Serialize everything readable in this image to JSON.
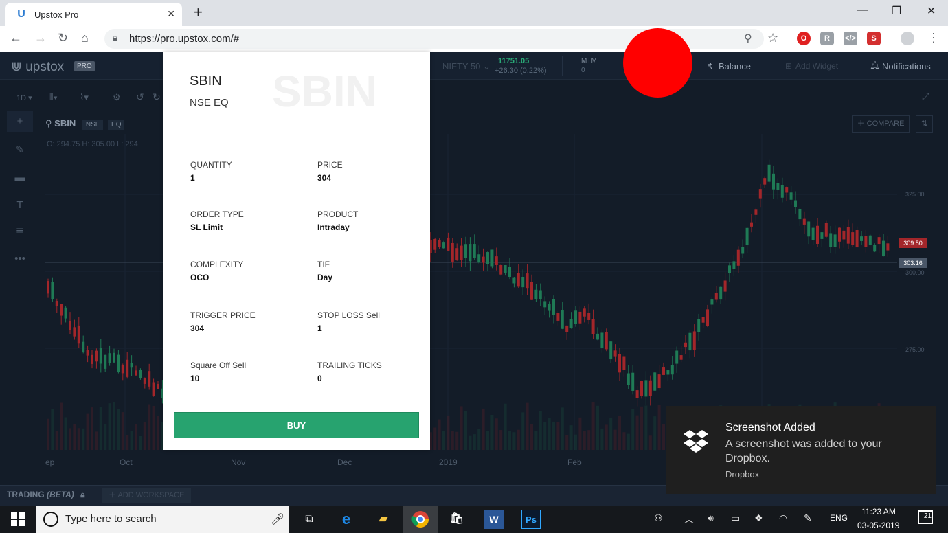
{
  "browser": {
    "tab_title": "Upstox Pro",
    "tab_close": "✕",
    "new_tab": "+",
    "url": "https://pro.upstox.com/#",
    "win_minimize": "—",
    "win_restore": "❐",
    "win_close": "✕"
  },
  "app": {
    "logo": "upstox",
    "logo_badge": "PRO",
    "nifty_label": "NIFTY 50",
    "nifty_value": "11751.05",
    "nifty_change": "+26.30 (0.22%)",
    "mtm_label": "MTM",
    "mtm_value": "0",
    "balance_label": "Balance",
    "add_widget_label": "Add Widget",
    "notifications_label": "Notifications"
  },
  "chart": {
    "interval": "1D",
    "symbol": "SBIN",
    "exchange": "NSE",
    "segment": "EQ",
    "ohlc": "O: 294.75   H: 305.00   L: 294",
    "compare_label": "COMPARE",
    "price_labels": [
      "325.00",
      "300.00",
      "275.00"
    ],
    "ask_tag": "309.50",
    "last_tag": "303.16",
    "x_labels": [
      "ep",
      "Oct",
      "Nov",
      "Dec",
      "2019",
      "Feb"
    ],
    "colors": {
      "up": "#1f7a55",
      "down": "#a3262a"
    }
  },
  "bottom": {
    "trading_label": "TRADING",
    "beta_label": "(BETA)",
    "add_workspace_label": "ADD WORKSPACE"
  },
  "order": {
    "symbol": "SBIN",
    "exchange_segment": "NSE EQ",
    "watermark": "SBIN",
    "fields": [
      {
        "label": "QUANTITY",
        "value": "1"
      },
      {
        "label": "PRICE",
        "value": "304"
      },
      {
        "label": "ORDER TYPE",
        "value": "SL Limit"
      },
      {
        "label": "PRODUCT",
        "value": "Intraday"
      },
      {
        "label": "COMPLEXITY",
        "value": "OCO"
      },
      {
        "label": "TIF",
        "value": "Day"
      },
      {
        "label": "TRIGGER PRICE",
        "value": "304"
      },
      {
        "label": "STOP LOSS Sell",
        "value": "1"
      },
      {
        "label": "Square Off Sell",
        "value": "10"
      },
      {
        "label": "TRAILING TICKS",
        "value": "0"
      }
    ],
    "buy_label": "BUY",
    "buy_color": "#27a36f"
  },
  "toast": {
    "title": "Screenshot Added",
    "body": "A screenshot was added to your Dropbox.",
    "app": "Dropbox"
  },
  "taskbar": {
    "search_placeholder": "Type here to search",
    "language": "ENG",
    "time": "11:23 AM",
    "date": "03-05-2019",
    "notifications_count": "21"
  }
}
